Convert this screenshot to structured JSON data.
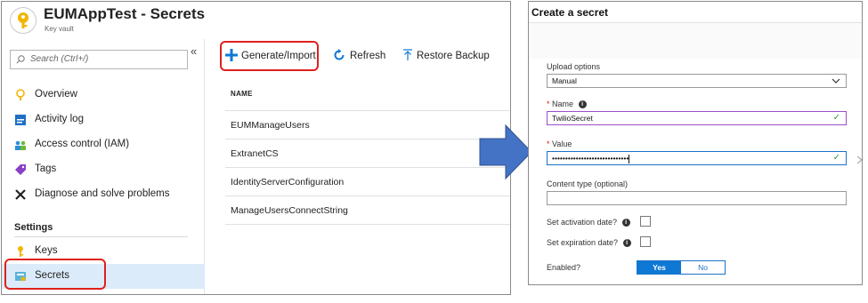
{
  "vault": {
    "title": "EUMAppTest - Secrets",
    "subtitle": "Key vault"
  },
  "sidebar": {
    "search_placeholder": "Search (Ctrl+/)",
    "collapse_glyph": "«",
    "items": [
      {
        "label": "Overview",
        "icon": "key-vault-icon"
      },
      {
        "label": "Activity log",
        "icon": "activity-log-icon"
      },
      {
        "label": "Access control (IAM)",
        "icon": "people-icon"
      },
      {
        "label": "Tags",
        "icon": "tag-icon"
      },
      {
        "label": "Diagnose and solve problems",
        "icon": "wrench-icon"
      }
    ],
    "section_label": "Settings",
    "settings_items": [
      {
        "label": "Keys",
        "icon": "key-icon"
      },
      {
        "label": "Secrets",
        "icon": "secrets-icon",
        "active": true
      }
    ]
  },
  "toolbar": {
    "generate_label": "Generate/Import",
    "refresh_label": "Refresh",
    "restore_label": "Restore Backup"
  },
  "table": {
    "column_header": "NAME",
    "rows": [
      "EUMManageUsers",
      "ExtranetCS",
      "IdentityServerConfiguration",
      "ManageUsersConnectString"
    ]
  },
  "create_secret": {
    "title": "Create a secret",
    "upload_label": "Upload options",
    "upload_value": "Manual",
    "required_mark": "*",
    "name_label": "Name",
    "name_value": "TwilioSecret",
    "value_label": "Value",
    "value_masked": "•••••••••••••••••••••••••••••",
    "content_type_label": "Content type (optional)",
    "activation_label": "Set activation date?",
    "expiration_label": "Set expiration date?",
    "enabled_label": "Enabled?",
    "yes_label": "Yes",
    "no_label": "No",
    "info_glyph": "i",
    "check_glyph": "✓"
  },
  "colors": {
    "highlight_red": "#e0201b",
    "azure_blue": "#0f78d4",
    "arrow_blue": "#4472c4",
    "active_nav_bg": "#dcebfa",
    "name_border_purple": "#9b4dca"
  }
}
